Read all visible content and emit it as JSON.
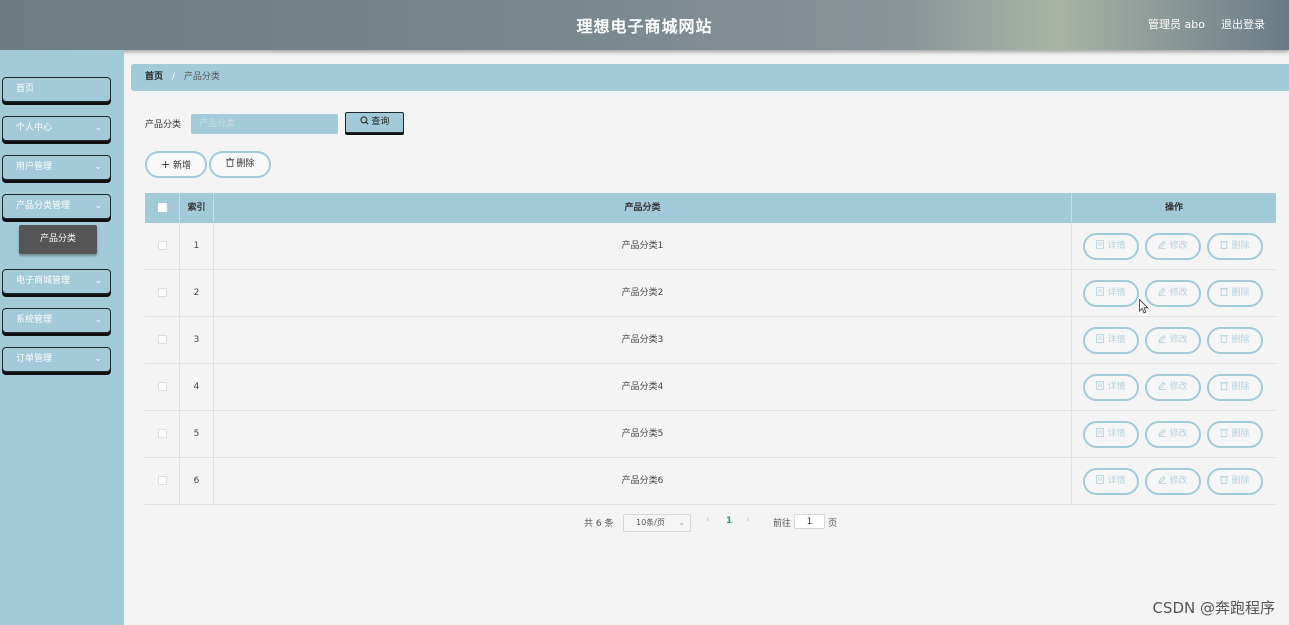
{
  "header": {
    "title": "理想电子商城网站",
    "admin": "管理员 abo",
    "logout": "退出登录"
  },
  "sidebar": {
    "items": [
      {
        "label": "首页",
        "has_chevron": false
      },
      {
        "label": "个人中心",
        "has_chevron": true
      },
      {
        "label": "用户管理",
        "has_chevron": true
      },
      {
        "label": "产品分类管理",
        "has_chevron": true
      },
      {
        "label": "电子商城管理",
        "has_chevron": true
      },
      {
        "label": "系统管理",
        "has_chevron": true
      },
      {
        "label": "订单管理",
        "has_chevron": true
      }
    ],
    "submenu": {
      "label": "产品分类"
    },
    "chevron_icon": "chevron-down-icon"
  },
  "breadcrumb": {
    "home": "首页",
    "separator": "/",
    "current": "产品分类"
  },
  "search": {
    "label": "产品分类",
    "placeholder": "产品分类",
    "button": "查询",
    "button_icon": "search-icon"
  },
  "actions": {
    "add": "新增",
    "add_icon": "plus-icon",
    "delete": "删除",
    "delete_icon": "trash-icon"
  },
  "table": {
    "columns": [
      "索引",
      "产品分类",
      "操作"
    ],
    "rows": [
      {
        "index": "1",
        "category": "产品分类1"
      },
      {
        "index": "2",
        "category": "产品分类2"
      },
      {
        "index": "3",
        "category": "产品分类3"
      },
      {
        "index": "4",
        "category": "产品分类4"
      },
      {
        "index": "5",
        "category": "产品分类5"
      },
      {
        "index": "6",
        "category": "产品分类6"
      }
    ],
    "row_actions": {
      "detail": "详情",
      "edit": "修改",
      "delete": "删除"
    }
  },
  "pagination": {
    "total": "共 6 条",
    "page_size": "10条/页",
    "current_page": "1",
    "goto_label": "前往",
    "goto_value": "1",
    "page_label": "页"
  },
  "watermark": "CSDN @奔跑程序",
  "colors": {
    "accent": "#a3cad8",
    "header": "#7a878e",
    "submenu_active": "#555555",
    "page_active": "#2aa57a"
  }
}
